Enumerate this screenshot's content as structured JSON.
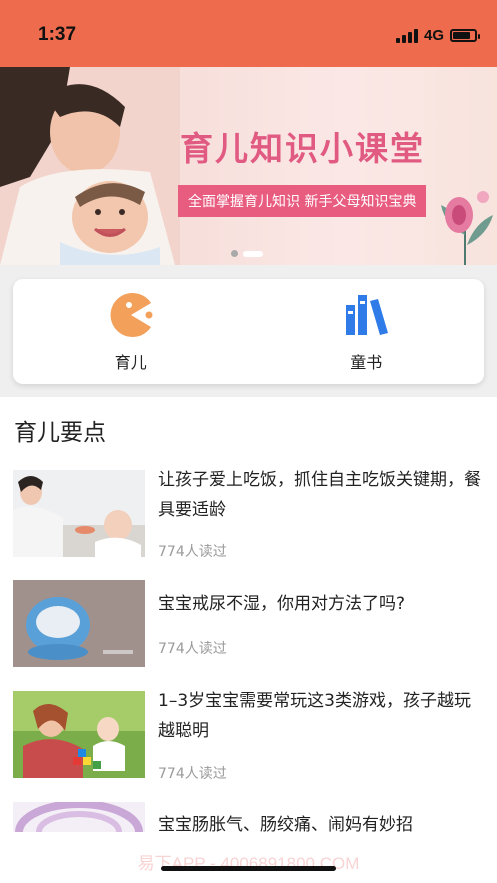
{
  "status_bar": {
    "time": "1:37",
    "network": "4G",
    "battery_level": 0.8
  },
  "banner": {
    "title": "育儿知识小课堂",
    "subtitle": "全面掌握育儿知识  新手父母知识宝典",
    "page_index": 2,
    "page_count": 2
  },
  "quick_nav": [
    {
      "label": "育儿",
      "icon": "pacman-icon",
      "color": "#f2a05a"
    },
    {
      "label": "童书",
      "icon": "books-icon",
      "color": "#2f7be8"
    }
  ],
  "section": {
    "title": "育儿要点"
  },
  "articles": [
    {
      "title": "让孩子爱上吃饭，抓住自主吃饭关键期，餐具要适龄",
      "reads": "774人读过"
    },
    {
      "title": "宝宝戒尿不湿，你用对方法了吗?",
      "reads": "774人读过"
    },
    {
      "title": "1–3岁宝宝需要常玩这3类游戏，孩子越玩越聪明",
      "reads": "774人读过"
    },
    {
      "title": "宝宝肠胀气、肠绞痛、闹妈有妙招",
      "reads": ""
    }
  ],
  "watermark": "易下APP - 4006891800.COM",
  "colors": {
    "header": "#ee6b4d",
    "banner_accent": "#e85c80",
    "muted_text": "#9a9a9a"
  }
}
